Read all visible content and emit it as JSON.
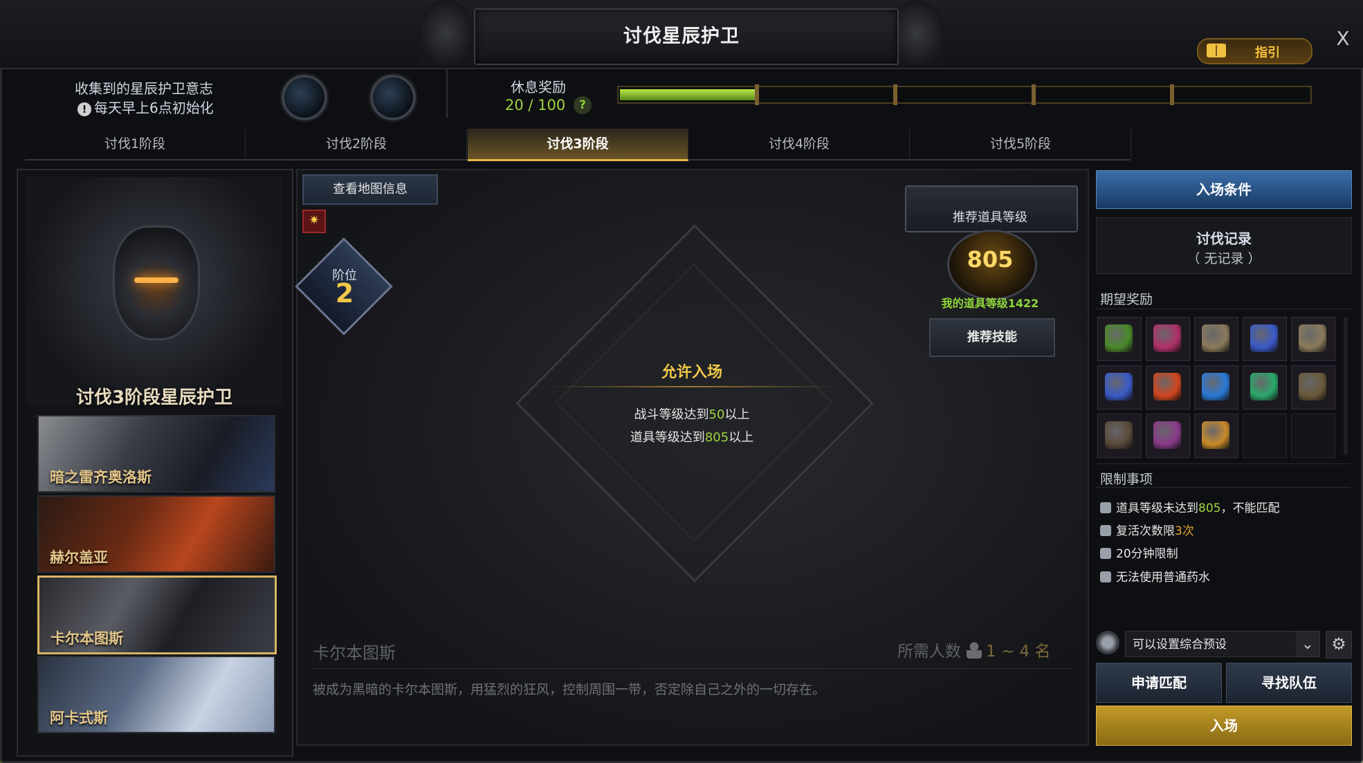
{
  "window": {
    "title": "讨伐星辰护卫",
    "guide_label": "指引",
    "close_label": "X"
  },
  "header_info": {
    "collected_label": "收集到的星辰护卫意志",
    "reset_note": "每天早上6点初始化",
    "rest_reward_label": "休息奖励",
    "rest_reward_value": "20 / 100",
    "rest_reward_fraction": 0.2,
    "help_label": "?"
  },
  "tabs": [
    {
      "label": "讨伐1阶段",
      "active": false
    },
    {
      "label": "讨伐2阶段",
      "active": false
    },
    {
      "label": "讨伐3阶段",
      "active": true
    },
    {
      "label": "讨伐4阶段",
      "active": false
    },
    {
      "label": "讨伐5阶段",
      "active": false
    }
  ],
  "left_panel": {
    "stage_title": "讨伐3阶段星辰护卫",
    "bosses": [
      {
        "name": "暗之雷齐奥洛斯",
        "selected": false
      },
      {
        "name": "赫尔盖亚",
        "selected": false
      },
      {
        "name": "卡尔本图斯",
        "selected": true
      },
      {
        "name": "阿卡式斯",
        "selected": false
      }
    ]
  },
  "center": {
    "map_info_button": "查看地图信息",
    "rank_label": "阶位",
    "rank_value": "2",
    "entry_status": "允许入场",
    "conditions": [
      {
        "prefix": "战斗等级达到",
        "value": "50",
        "suffix": "以上"
      },
      {
        "prefix": "道具等级达到",
        "value": "805",
        "suffix": "以上"
      }
    ],
    "recommended_label": "推荐道具等级",
    "recommended_value": "805",
    "my_item_level": "我的道具等级1422",
    "recommend_skill_button": "推荐技能",
    "zone_name": "卡尔本图斯",
    "party_label": "所需人数",
    "party_count": "1 ~ 4 名",
    "zone_description": "被成为黑暗的卡尔本图斯，用猛烈的狂风，控制周围一带，否定除自己之外的一切存在。"
  },
  "right_panel": {
    "entry_conditions_button": "入场条件",
    "record_title": "讨伐记录",
    "record_value": "（ 无记录 ）",
    "rewards_title": "期望奖励",
    "rewards": [
      {
        "icon": "gift-box-icon",
        "color": "#4a8a2a"
      },
      {
        "icon": "amulet-icon",
        "color": "#b0306a"
      },
      {
        "icon": "earring-icon",
        "color": "#8a7a5a"
      },
      {
        "icon": "ring-icon",
        "color": "#3a5ac8"
      },
      {
        "icon": "earring-icon",
        "color": "#8a7a5a"
      },
      {
        "icon": "ring-icon",
        "color": "#3a5ac8"
      },
      {
        "icon": "red-crystal-icon",
        "color": "#d2461e"
      },
      {
        "icon": "blue-crystal-icon",
        "color": "#2a7ad8"
      },
      {
        "icon": "green-gem-icon",
        "color": "#2aa86a"
      },
      {
        "icon": "mystery-box-icon",
        "color": "#6a5a3a"
      },
      {
        "icon": "card-icon",
        "color": "#5a4a3a"
      },
      {
        "icon": "book-icon",
        "color": "#8a3a8a"
      },
      {
        "icon": "rune-icon",
        "color": "#c88a2a"
      },
      {
        "icon": "empty-slot-icon",
        "color": ""
      },
      {
        "icon": "empty-slot-icon",
        "color": ""
      }
    ],
    "restrictions_title": "限制事项",
    "restrictions": [
      {
        "icon": "shield-icon",
        "prefix": "道具等级未达到",
        "value": "805",
        "suffix": "，不能匹配",
        "value_color": "green"
      },
      {
        "icon": "feather-icon",
        "prefix": "复活次数限",
        "value": "3次",
        "suffix": "",
        "value_color": "orange"
      },
      {
        "icon": "hourglass-icon",
        "prefix": "20分钟限制",
        "value": "",
        "suffix": "",
        "value_color": ""
      },
      {
        "icon": "potion-icon",
        "prefix": "无法使用普通药水",
        "value": "",
        "suffix": "",
        "value_color": ""
      }
    ],
    "preset_select": "可以设置综合预设",
    "apply_match_button": "申请匹配",
    "find_party_button": "寻找队伍",
    "enter_button": "入场"
  },
  "colors": {
    "accent_gold": "#e4b948",
    "green_value": "#9fd63e",
    "enter_button": "#c29a28",
    "entry_cond_blue": "#3a6ea8"
  }
}
